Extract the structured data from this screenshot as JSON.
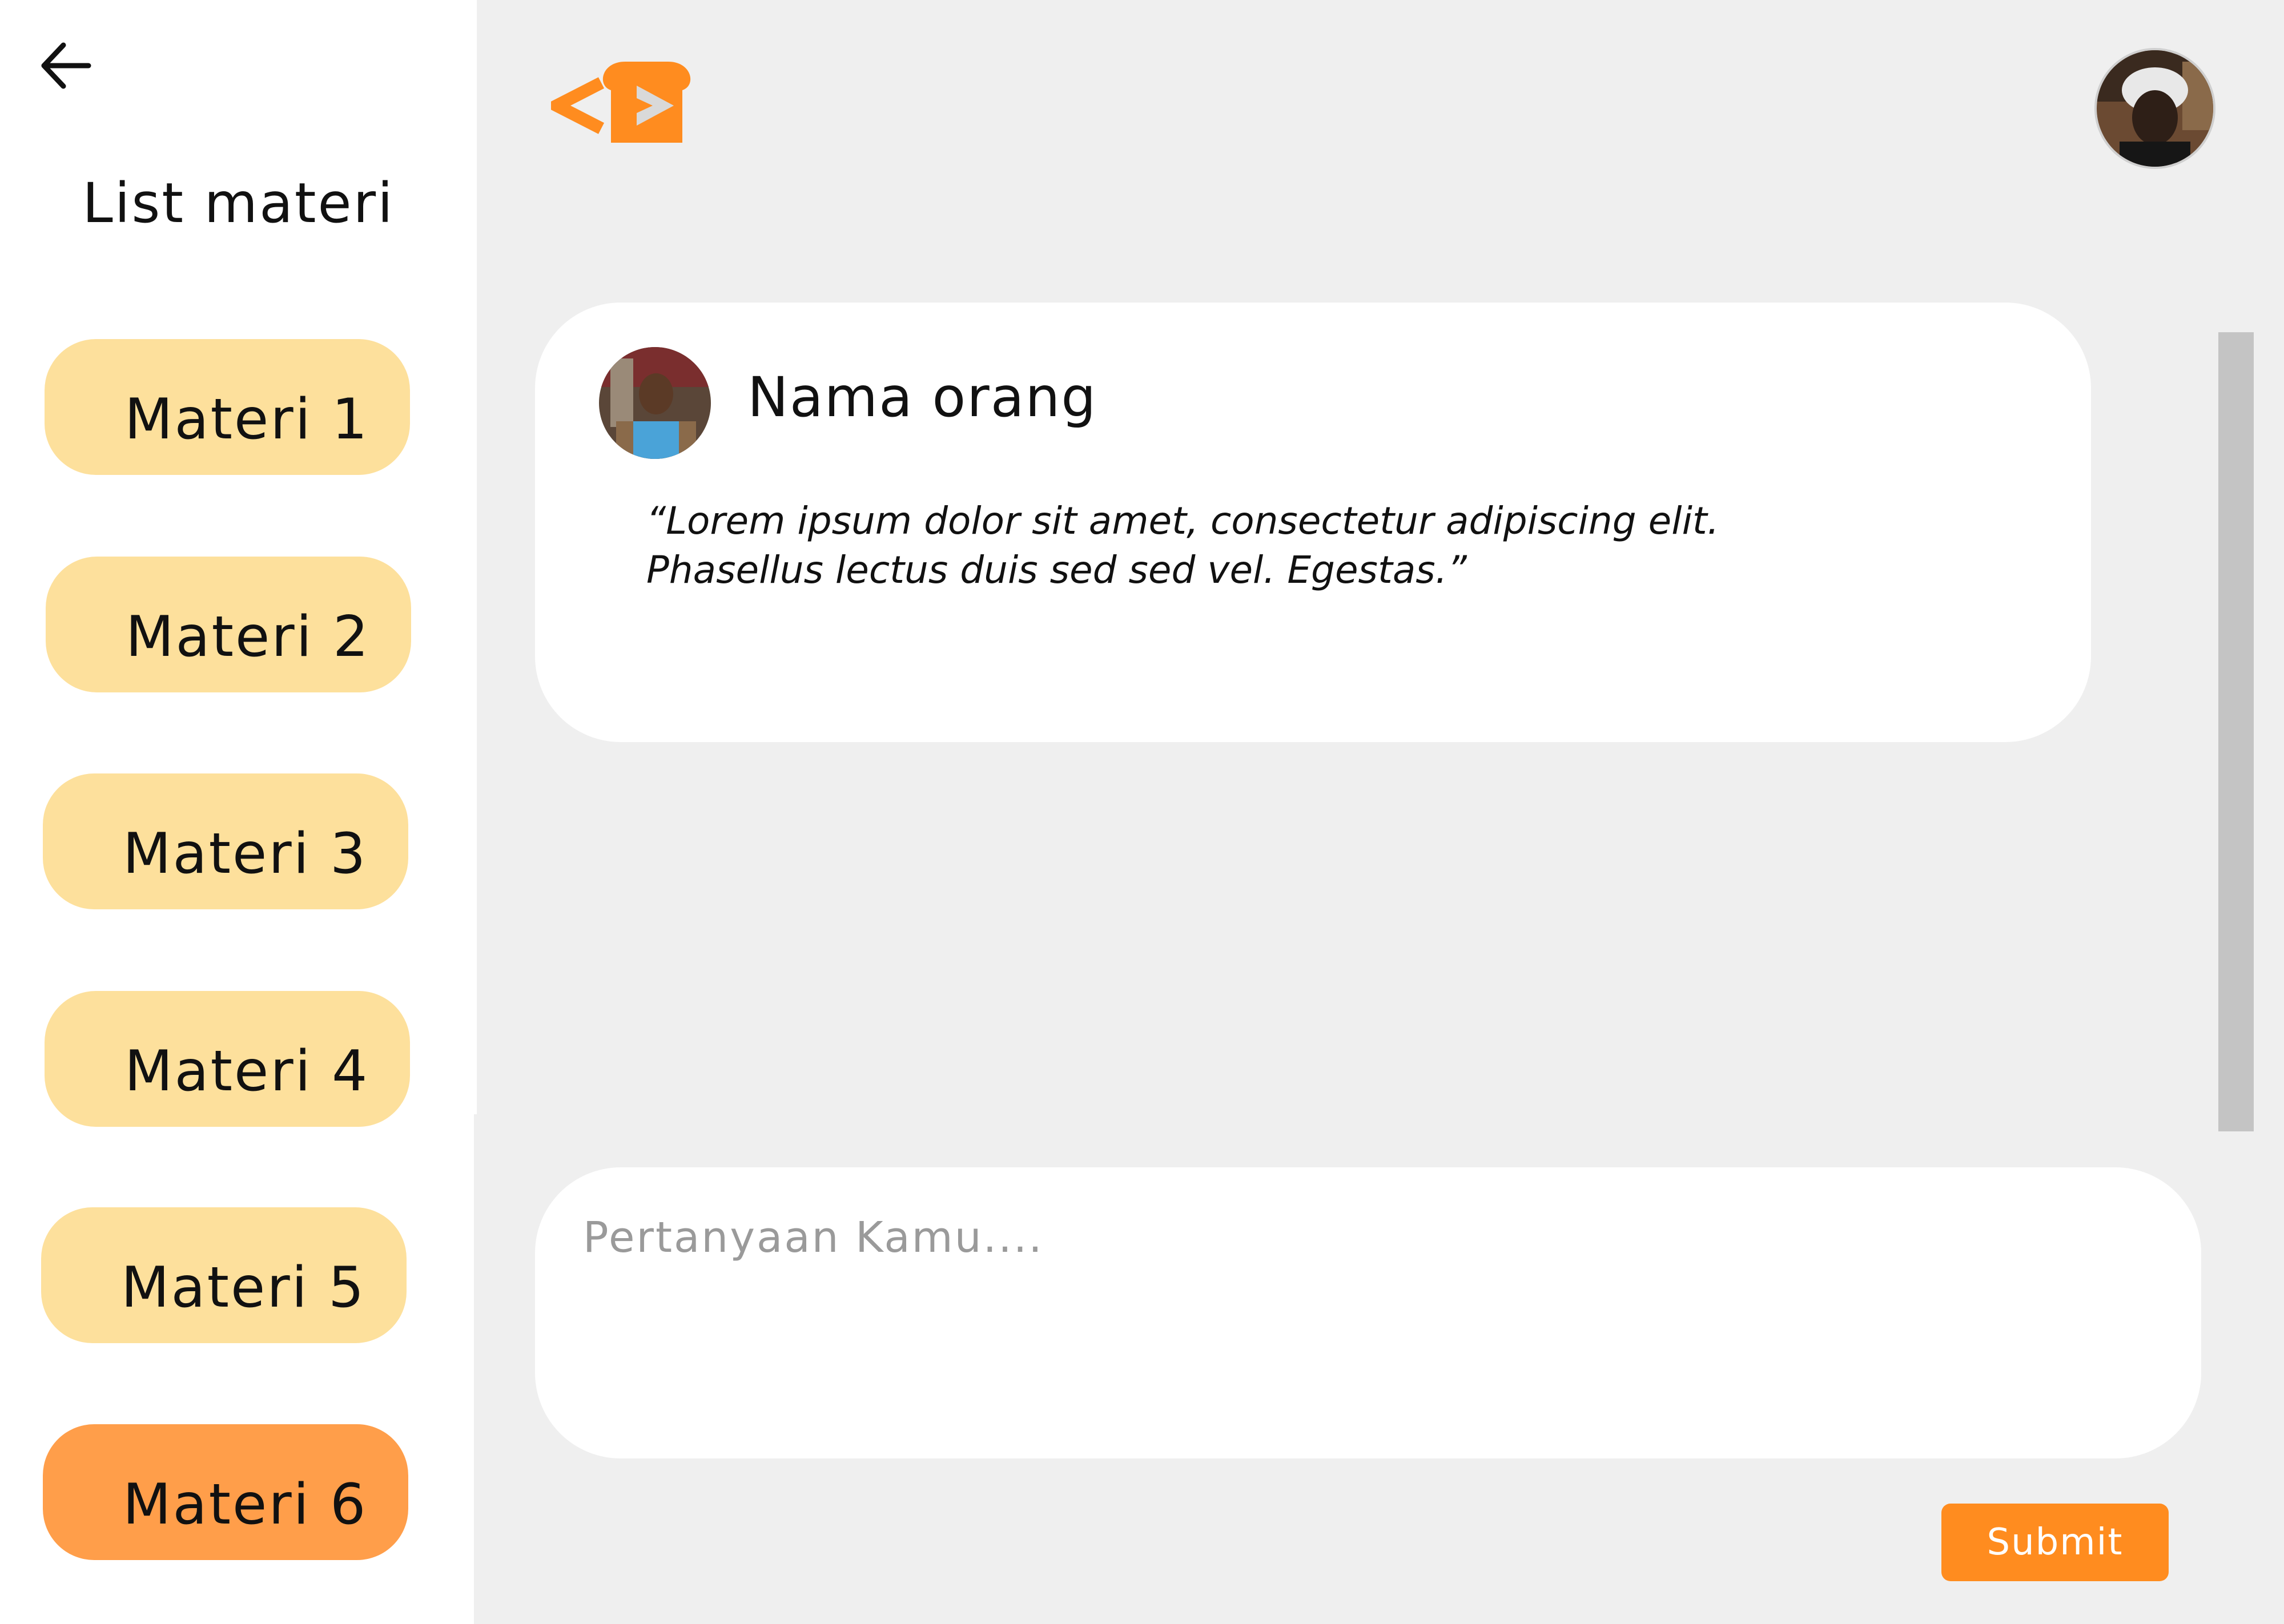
{
  "sidebar": {
    "title": "List materi",
    "items": [
      {
        "label": "Materi 1",
        "active": false
      },
      {
        "label": "Materi 2",
        "active": false
      },
      {
        "label": "Materi 3",
        "active": false
      },
      {
        "label": "Materi 4",
        "active": false
      },
      {
        "label": "Materi 5",
        "active": false
      },
      {
        "label": "Materi 6",
        "active": true
      }
    ],
    "item_color": "#fde09c",
    "active_color": "#ff9e4a"
  },
  "header": {
    "logo_icon": "code-brackets-logo",
    "brand_color": "#ff8c1f"
  },
  "comment": {
    "name": "Nama orang",
    "text": "“Lorem ipsum dolor sit amet, consectetur adipiscing elit. Phasellus lectus duis sed sed vel. Egestas.”"
  },
  "question": {
    "placeholder": "Pertanyaan Kamu....",
    "value": ""
  },
  "submit": {
    "label": "Submit"
  }
}
